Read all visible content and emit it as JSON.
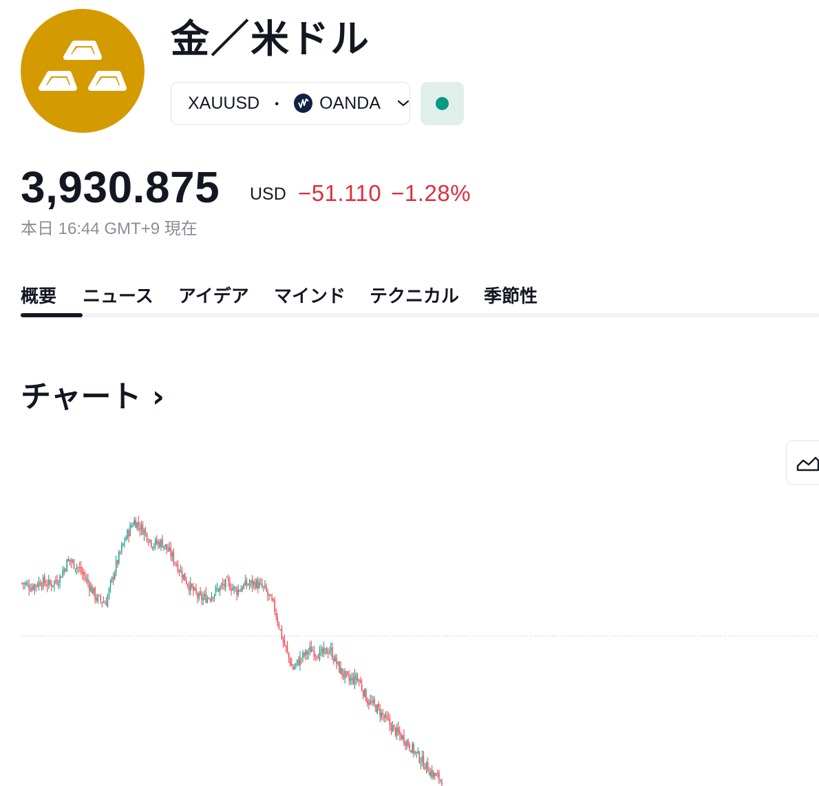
{
  "header": {
    "title": "金／米ドル",
    "logo_icon": "gold-bars-icon",
    "symbol": "XAUUSD",
    "separator": "・",
    "exchange": "OANDA",
    "exchange_icon": "oanda-logo-icon",
    "dropdown_icon": "chevron-down-icon",
    "market_status_color": "#089981"
  },
  "quote": {
    "price": "3,930.875",
    "currency": "USD",
    "change": "−51.110",
    "change_percent": "−1.28%",
    "timestamp": "本日 16:44 GMT+9 現在",
    "change_color": "#e02d3c"
  },
  "tabs": [
    {
      "label": "概要",
      "active": true
    },
    {
      "label": "ニュース",
      "active": false
    },
    {
      "label": "アイデア",
      "active": false
    },
    {
      "label": "マインド",
      "active": false
    },
    {
      "label": "テクニカル",
      "active": false
    },
    {
      "label": "季節性",
      "active": false
    }
  ],
  "section": {
    "chart_title": "チャート ›",
    "chart_type_icon": "area-chart-icon"
  },
  "chart_data": {
    "type": "candlestick",
    "symbol": "XAUUSD",
    "up_color": "#089981",
    "down_color": "#f23645",
    "grid": false,
    "reference_line": "dotted",
    "close_trend": [
      4060,
      4055,
      4062,
      4058,
      4066,
      4090,
      4080,
      4062,
      4040,
      4035,
      4080,
      4115,
      4140,
      4128,
      4110,
      4112,
      4096,
      4075,
      4055,
      4040,
      4042,
      4052,
      4060,
      4050,
      4058,
      4060,
      4052,
      4030,
      3985,
      3950,
      3965,
      3975,
      3968,
      3975,
      3950,
      3935,
      3938,
      3910,
      3900,
      3885,
      3870,
      3860,
      3845,
      3830,
      3815,
      3808
    ]
  }
}
